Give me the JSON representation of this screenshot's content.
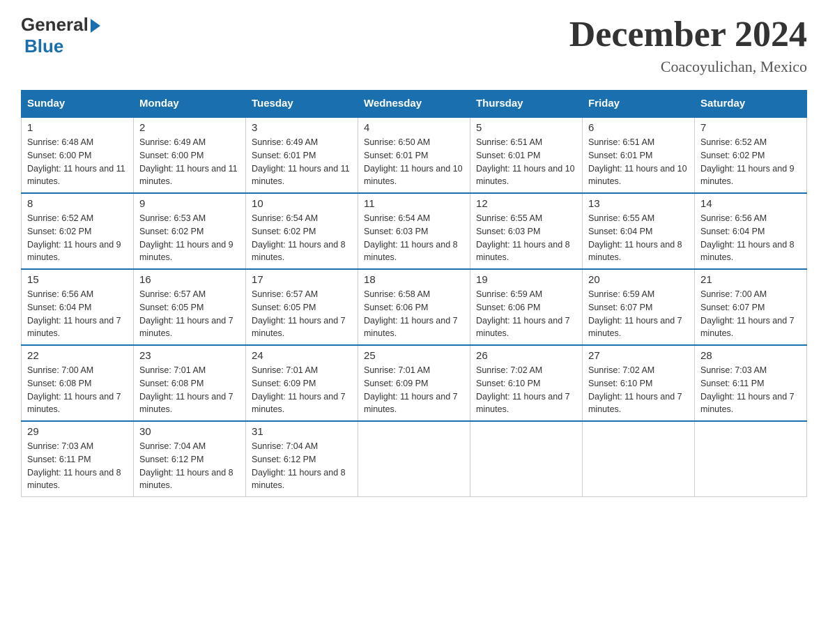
{
  "logo": {
    "general": "General",
    "blue": "Blue"
  },
  "title": "December 2024",
  "subtitle": "Coacoyulichan, Mexico",
  "days_of_week": [
    "Sunday",
    "Monday",
    "Tuesday",
    "Wednesday",
    "Thursday",
    "Friday",
    "Saturday"
  ],
  "weeks": [
    [
      {
        "day": "1",
        "sunrise": "6:48 AM",
        "sunset": "6:00 PM",
        "daylight": "11 hours and 11 minutes."
      },
      {
        "day": "2",
        "sunrise": "6:49 AM",
        "sunset": "6:00 PM",
        "daylight": "11 hours and 11 minutes."
      },
      {
        "day": "3",
        "sunrise": "6:49 AM",
        "sunset": "6:01 PM",
        "daylight": "11 hours and 11 minutes."
      },
      {
        "day": "4",
        "sunrise": "6:50 AM",
        "sunset": "6:01 PM",
        "daylight": "11 hours and 10 minutes."
      },
      {
        "day": "5",
        "sunrise": "6:51 AM",
        "sunset": "6:01 PM",
        "daylight": "11 hours and 10 minutes."
      },
      {
        "day": "6",
        "sunrise": "6:51 AM",
        "sunset": "6:01 PM",
        "daylight": "11 hours and 10 minutes."
      },
      {
        "day": "7",
        "sunrise": "6:52 AM",
        "sunset": "6:02 PM",
        "daylight": "11 hours and 9 minutes."
      }
    ],
    [
      {
        "day": "8",
        "sunrise": "6:52 AM",
        "sunset": "6:02 PM",
        "daylight": "11 hours and 9 minutes."
      },
      {
        "day": "9",
        "sunrise": "6:53 AM",
        "sunset": "6:02 PM",
        "daylight": "11 hours and 9 minutes."
      },
      {
        "day": "10",
        "sunrise": "6:54 AM",
        "sunset": "6:02 PM",
        "daylight": "11 hours and 8 minutes."
      },
      {
        "day": "11",
        "sunrise": "6:54 AM",
        "sunset": "6:03 PM",
        "daylight": "11 hours and 8 minutes."
      },
      {
        "day": "12",
        "sunrise": "6:55 AM",
        "sunset": "6:03 PM",
        "daylight": "11 hours and 8 minutes."
      },
      {
        "day": "13",
        "sunrise": "6:55 AM",
        "sunset": "6:04 PM",
        "daylight": "11 hours and 8 minutes."
      },
      {
        "day": "14",
        "sunrise": "6:56 AM",
        "sunset": "6:04 PM",
        "daylight": "11 hours and 8 minutes."
      }
    ],
    [
      {
        "day": "15",
        "sunrise": "6:56 AM",
        "sunset": "6:04 PM",
        "daylight": "11 hours and 7 minutes."
      },
      {
        "day": "16",
        "sunrise": "6:57 AM",
        "sunset": "6:05 PM",
        "daylight": "11 hours and 7 minutes."
      },
      {
        "day": "17",
        "sunrise": "6:57 AM",
        "sunset": "6:05 PM",
        "daylight": "11 hours and 7 minutes."
      },
      {
        "day": "18",
        "sunrise": "6:58 AM",
        "sunset": "6:06 PM",
        "daylight": "11 hours and 7 minutes."
      },
      {
        "day": "19",
        "sunrise": "6:59 AM",
        "sunset": "6:06 PM",
        "daylight": "11 hours and 7 minutes."
      },
      {
        "day": "20",
        "sunrise": "6:59 AM",
        "sunset": "6:07 PM",
        "daylight": "11 hours and 7 minutes."
      },
      {
        "day": "21",
        "sunrise": "7:00 AM",
        "sunset": "6:07 PM",
        "daylight": "11 hours and 7 minutes."
      }
    ],
    [
      {
        "day": "22",
        "sunrise": "7:00 AM",
        "sunset": "6:08 PM",
        "daylight": "11 hours and 7 minutes."
      },
      {
        "day": "23",
        "sunrise": "7:01 AM",
        "sunset": "6:08 PM",
        "daylight": "11 hours and 7 minutes."
      },
      {
        "day": "24",
        "sunrise": "7:01 AM",
        "sunset": "6:09 PM",
        "daylight": "11 hours and 7 minutes."
      },
      {
        "day": "25",
        "sunrise": "7:01 AM",
        "sunset": "6:09 PM",
        "daylight": "11 hours and 7 minutes."
      },
      {
        "day": "26",
        "sunrise": "7:02 AM",
        "sunset": "6:10 PM",
        "daylight": "11 hours and 7 minutes."
      },
      {
        "day": "27",
        "sunrise": "7:02 AM",
        "sunset": "6:10 PM",
        "daylight": "11 hours and 7 minutes."
      },
      {
        "day": "28",
        "sunrise": "7:03 AM",
        "sunset": "6:11 PM",
        "daylight": "11 hours and 7 minutes."
      }
    ],
    [
      {
        "day": "29",
        "sunrise": "7:03 AM",
        "sunset": "6:11 PM",
        "daylight": "11 hours and 8 minutes."
      },
      {
        "day": "30",
        "sunrise": "7:04 AM",
        "sunset": "6:12 PM",
        "daylight": "11 hours and 8 minutes."
      },
      {
        "day": "31",
        "sunrise": "7:04 AM",
        "sunset": "6:12 PM",
        "daylight": "11 hours and 8 minutes."
      },
      null,
      null,
      null,
      null
    ]
  ]
}
